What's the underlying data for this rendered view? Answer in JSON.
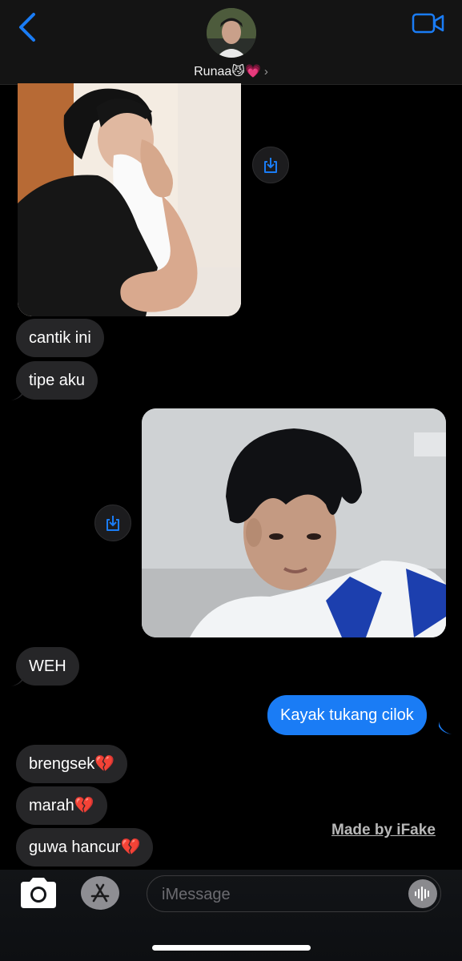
{
  "header": {
    "contact_name": "Runaa😼💗",
    "chevron": "›",
    "back_icon": "chevron-left-icon",
    "video_icon": "video-camera-icon",
    "accent": "#1a7cf5"
  },
  "messages": [
    {
      "type": "image",
      "direction": "incoming",
      "alt": "photo-man-pillow"
    },
    {
      "type": "text",
      "direction": "incoming",
      "text": "cantik ini"
    },
    {
      "type": "text",
      "direction": "incoming",
      "text": "tipe aku"
    },
    {
      "type": "image",
      "direction": "incoming",
      "alt": "photo-man-selfie"
    },
    {
      "type": "text",
      "direction": "incoming",
      "text": "WEH"
    },
    {
      "type": "text",
      "direction": "outgoing",
      "text": "Kayak tukang cilok"
    },
    {
      "type": "text",
      "direction": "incoming",
      "text": "brengsek💔"
    },
    {
      "type": "text",
      "direction": "incoming",
      "text": "marah💔"
    },
    {
      "type": "text",
      "direction": "incoming",
      "text": "guwa hancur💔"
    }
  ],
  "watermark": "Made by iFake",
  "composer": {
    "placeholder": "iMessage",
    "camera_icon": "camera-icon",
    "apps_icon": "app-store-icon",
    "audio_icon": "audio-waveform-icon"
  }
}
